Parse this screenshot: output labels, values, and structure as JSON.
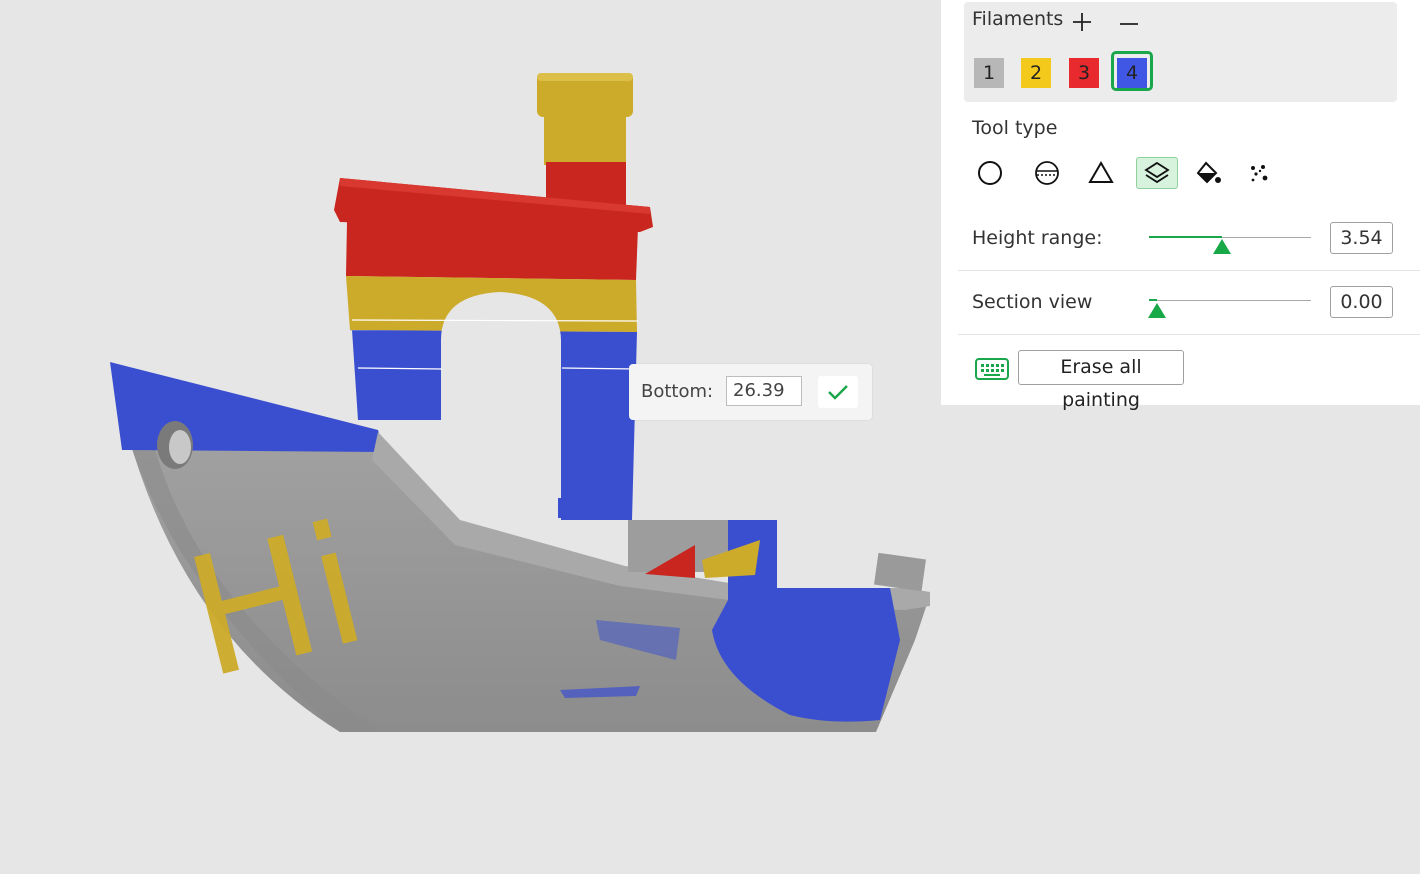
{
  "filaments": {
    "title": "Filaments",
    "add_icon": "plus-icon",
    "remove_icon": "minus-icon",
    "swatches": [
      {
        "label": "1",
        "color": "#b7b7b7"
      },
      {
        "label": "2",
        "color": "#f3c91b"
      },
      {
        "label": "3",
        "color": "#e8292d"
      },
      {
        "label": "4",
        "color": "#4057e6"
      }
    ],
    "selected": "4",
    "selected_color": "#1aa64b"
  },
  "tool_type": {
    "title": "Tool type",
    "tools": [
      {
        "name": "circle-brush-icon"
      },
      {
        "name": "sphere-brush-icon"
      },
      {
        "name": "triangle-tool-icon"
      },
      {
        "name": "height-range-tool-icon",
        "active": true
      },
      {
        "name": "fill-bucket-icon"
      },
      {
        "name": "gap-fill-icon"
      }
    ]
  },
  "height_range": {
    "label": "Height range:",
    "value": "3.54",
    "fraction": 0.45
  },
  "section_view": {
    "label": "Section view",
    "value": "0.00",
    "fraction": 0.05
  },
  "erase": {
    "label": "Erase all painting",
    "icon": "keyboard-icon"
  },
  "bottom_tip": {
    "label": "Bottom:",
    "value": "26.39",
    "confirm_icon": "checkmark-icon"
  },
  "model": {
    "hull_text": "Hi",
    "colors": {
      "gray": "#9a9a9a",
      "yellow": "#cdab2a",
      "red": "#c9261f",
      "blue": "#3a4fd0",
      "background": "#e6e6e6"
    }
  }
}
